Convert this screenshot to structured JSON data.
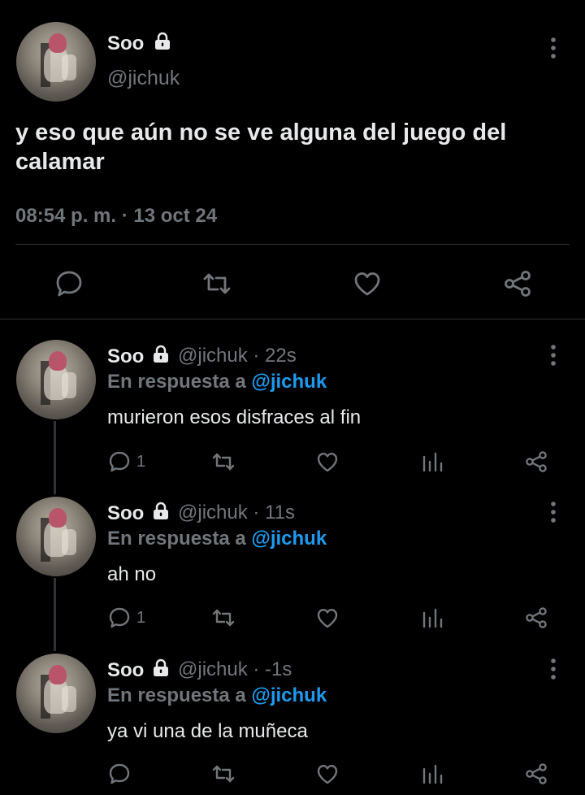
{
  "main_tweet": {
    "name": "Soo",
    "handle": "@jichuk",
    "text": "y eso que aún no se ve alguna del juego del calamar",
    "timestamp": "08:54 p. m. · 13 oct 24",
    "icons": [
      "reply-icon",
      "retweet-icon",
      "like-icon",
      "share-icon"
    ]
  },
  "replies": [
    {
      "name": "Soo",
      "handle_time": "@jichuk · 22s",
      "reply_prefix": "En respuesta a",
      "reply_mention": "@jichuk",
      "text": "murieron esos disfraces al fin",
      "reply_count": "1"
    },
    {
      "name": "Soo",
      "handle_time": "@jichuk · 11s",
      "reply_prefix": "En respuesta a",
      "reply_mention": "@jichuk",
      "text": "ah no",
      "reply_count": "1"
    },
    {
      "name": "Soo",
      "handle_time": "@jichuk · -1s",
      "reply_prefix": "En respuesta a",
      "reply_mention": "@jichuk",
      "text": "ya vi una de la muñeca",
      "reply_count": ""
    }
  ],
  "colors": {
    "background": "#000000",
    "primary_text": "#e7e9ea",
    "secondary_text": "#71767b",
    "accent": "#1d9bf0",
    "divider": "#2f3336"
  }
}
